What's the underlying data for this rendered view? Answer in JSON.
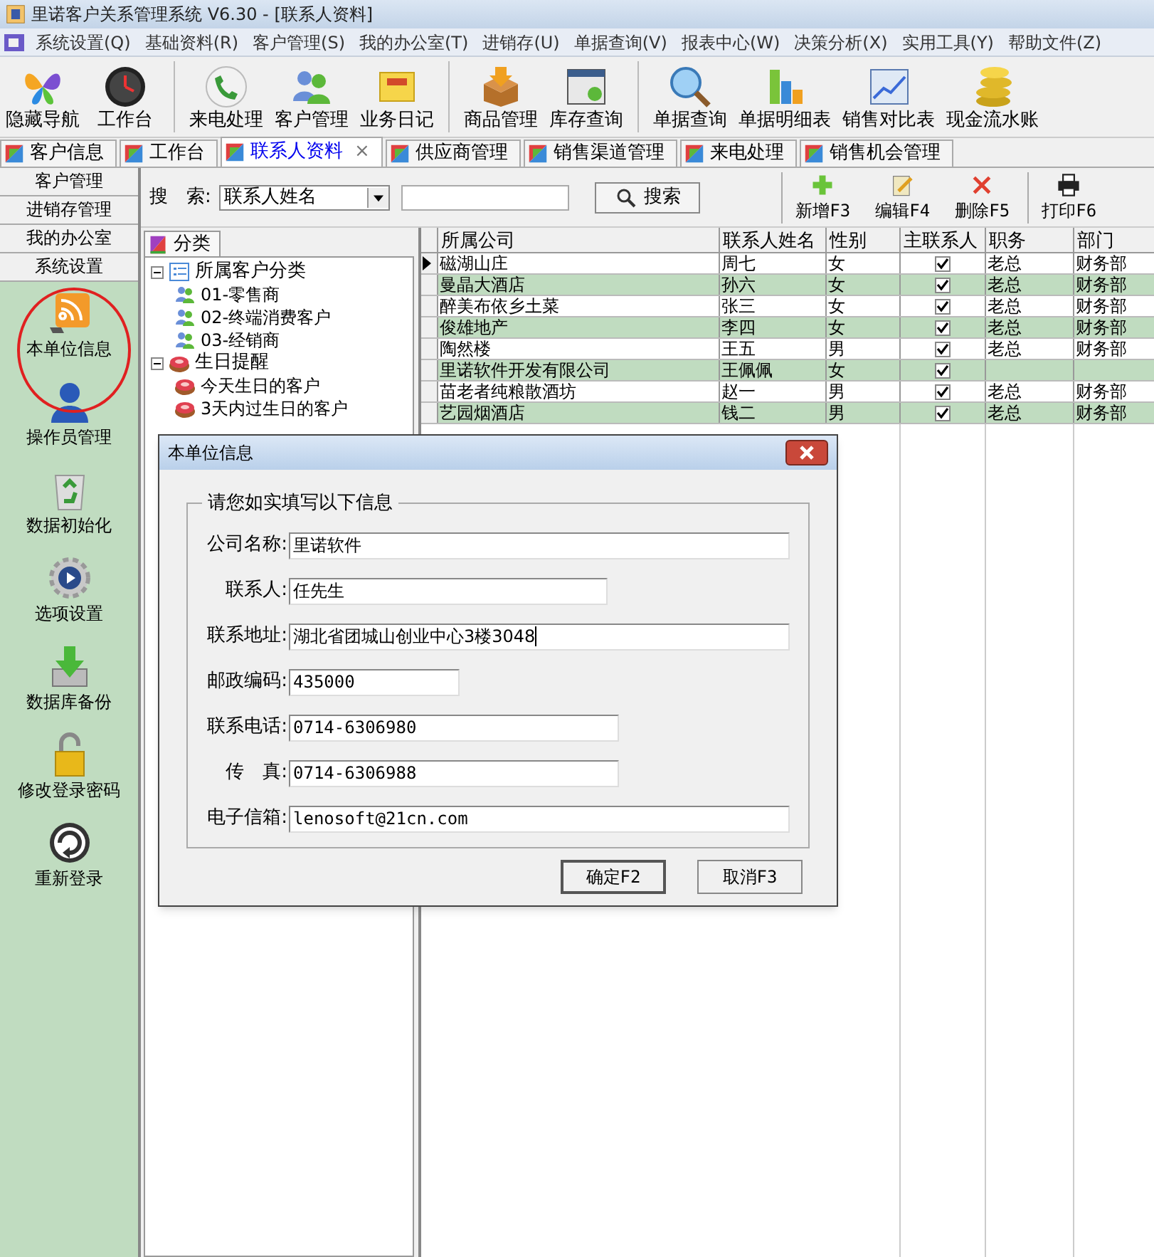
{
  "window": {
    "title": "里诺客户关系管理系统 V6.30 - [联系人资料]"
  },
  "menu": [
    "系统设置(Q)",
    "基础资料(R)",
    "客户管理(S)",
    "我的办公室(T)",
    "进销存(U)",
    "单据查询(V)",
    "报表中心(W)",
    "决策分析(X)",
    "实用工具(Y)",
    "帮助文件(Z)"
  ],
  "toolbar": [
    {
      "label": "隐藏导航"
    },
    {
      "label": "工作台"
    },
    {
      "label": "来电处理"
    },
    {
      "label": "客户管理"
    },
    {
      "label": "业务日记"
    },
    {
      "label": "商品管理"
    },
    {
      "label": "库存查询"
    },
    {
      "label": "单据查询"
    },
    {
      "label": "单据明细表"
    },
    {
      "label": "销售对比表"
    },
    {
      "label": "现金流水账"
    }
  ],
  "tabs": [
    {
      "label": "客户信息",
      "selected": false
    },
    {
      "label": "工作台",
      "selected": false
    },
    {
      "label": "联系人资料",
      "selected": true,
      "close": "×"
    },
    {
      "label": "供应商管理",
      "selected": false
    },
    {
      "label": "销售渠道管理",
      "selected": false
    },
    {
      "label": "来电处理",
      "selected": false
    },
    {
      "label": "销售机会管理",
      "selected": false
    }
  ],
  "sidebar": {
    "sections": [
      "客户管理",
      "进销存管理",
      "我的办公室",
      "系统设置"
    ],
    "items": [
      {
        "label": "本单位信息",
        "circled": true
      },
      {
        "label": "操作员管理",
        "circled": false
      },
      {
        "label": "数据初始化",
        "circled": false
      },
      {
        "label": "选项设置",
        "circled": false
      },
      {
        "label": "数据库备份",
        "circled": false
      },
      {
        "label": "修改登录密码",
        "circled": false
      },
      {
        "label": "重新登录",
        "circled": false
      }
    ]
  },
  "search": {
    "label": "搜　索:",
    "field": "联系人姓名",
    "button": "搜索"
  },
  "actions": [
    "新增F3",
    "编辑F4",
    "删除F5",
    "打印F6"
  ],
  "category_tab": "分类",
  "tree": [
    {
      "label": "所属客户分类",
      "kind": "group",
      "expanded": true,
      "children": [
        {
          "label": "01-零售商",
          "kind": "people"
        },
        {
          "label": "02-终端消费客户",
          "kind": "people"
        },
        {
          "label": "03-经销商",
          "kind": "people"
        }
      ]
    },
    {
      "label": "生日提醒",
      "kind": "cake",
      "expanded": true,
      "children": [
        {
          "label": "今天生日的客户",
          "kind": "cake"
        },
        {
          "label": "3天内过生日的客户",
          "kind": "cake"
        }
      ]
    }
  ],
  "table": {
    "columns": [
      "所属公司",
      "联系人姓名",
      "性别",
      "主联系人",
      "职务",
      "部门"
    ],
    "rows": [
      {
        "cells": [
          "磁湖山庄",
          "周七",
          "女",
          "",
          "老总",
          "财务部"
        ],
        "primary": true,
        "selected": true
      },
      {
        "cells": [
          "曼晶大酒店",
          "孙六",
          "女",
          "",
          "老总",
          "财务部"
        ],
        "primary": true,
        "selected": false
      },
      {
        "cells": [
          "醉美布依乡土菜",
          "张三",
          "女",
          "",
          "老总",
          "财务部"
        ],
        "primary": true,
        "selected": false
      },
      {
        "cells": [
          "俊雄地产",
          "李四",
          "女",
          "",
          "老总",
          "财务部"
        ],
        "primary": true,
        "selected": false
      },
      {
        "cells": [
          "陶然楼",
          "王五",
          "男",
          "",
          "老总",
          "财务部"
        ],
        "primary": true,
        "selected": false
      },
      {
        "cells": [
          "里诺软件开发有限公司",
          "王佩佩",
          "女",
          "",
          "",
          ""
        ],
        "primary": true,
        "selected": false
      },
      {
        "cells": [
          "苗老者纯粮散酒坊",
          "赵一",
          "男",
          "",
          "老总",
          "财务部"
        ],
        "primary": true,
        "selected": false
      },
      {
        "cells": [
          "艺园烟酒店",
          "钱二",
          "男",
          "",
          "老总",
          "财务部"
        ],
        "primary": true,
        "selected": false
      }
    ]
  },
  "dialog": {
    "title": "本单位信息",
    "group_title": "请您如实填写以下信息",
    "fields": [
      {
        "label": "公司名称:",
        "value": "里诺软件"
      },
      {
        "label": "联系人:",
        "value": "任先生"
      },
      {
        "label": "联系地址:",
        "value": "湖北省团城山创业中心3楼3048",
        "focused": true
      },
      {
        "label": "邮政编码:",
        "value": "435000"
      },
      {
        "label": "联系电话:",
        "value": "0714-6306980"
      },
      {
        "label": "传　真:",
        "value": "0714-6306988"
      },
      {
        "label": "电子信箱:",
        "value": "lenosoft@21cn.com"
      }
    ],
    "buttons": [
      "确定F2",
      "取消F3"
    ]
  }
}
